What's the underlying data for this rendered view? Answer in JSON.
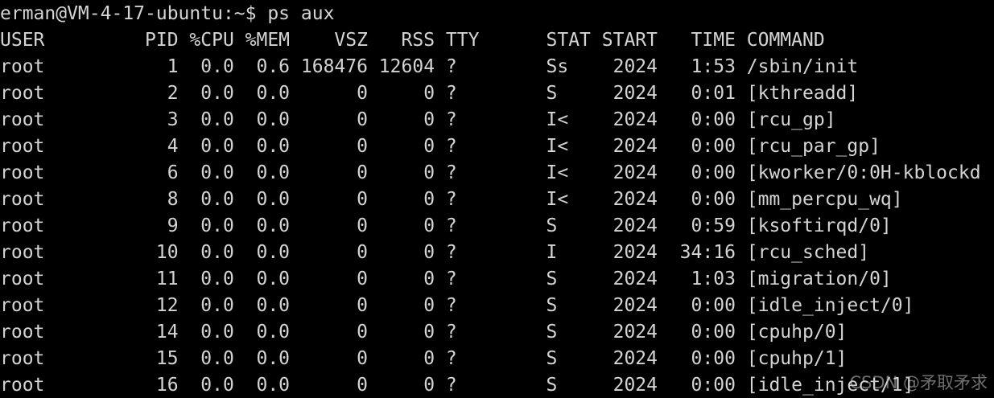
{
  "terminal": {
    "prompt_line": "erman@VM-4-17-ubuntu:~$ ps aux",
    "header_line": "USER         PID %CPU %MEM    VSZ   RSS TTY      STAT START   TIME COMMAND",
    "rows": [
      "root           1  0.0  0.6 168476 12604 ?        Ss    2024   1:53 /sbin/init",
      "root           2  0.0  0.0      0     0 ?        S     2024   0:01 [kthreadd]",
      "root           3  0.0  0.0      0     0 ?        I<    2024   0:00 [rcu_gp]",
      "root           4  0.0  0.0      0     0 ?        I<    2024   0:00 [rcu_par_gp]",
      "root           6  0.0  0.0      0     0 ?        I<    2024   0:00 [kworker/0:0H-kblockd",
      "root           8  0.0  0.0      0     0 ?        I<    2024   0:00 [mm_percpu_wq]",
      "root           9  0.0  0.0      0     0 ?        S     2024   0:59 [ksoftirqd/0]",
      "root          10  0.0  0.0      0     0 ?        I     2024  34:16 [rcu_sched]",
      "root          11  0.0  0.0      0     0 ?        S     2024   1:03 [migration/0]",
      "root          12  0.0  0.0      0     0 ?        S     2024   0:00 [idle_inject/0]",
      "root          14  0.0  0.0      0     0 ?        S     2024   0:00 [cpuhp/0]",
      "root          15  0.0  0.0      0     0 ?        S     2024   0:00 [cpuhp/1]",
      "root          16  0.0  0.0      0     0 ?        S     2024   0:00 [idle_inject/1]"
    ],
    "text_color": "#d4d4d4",
    "background_color": "#000000"
  },
  "watermark": {
    "text": "CSDN @矛取矛求"
  }
}
